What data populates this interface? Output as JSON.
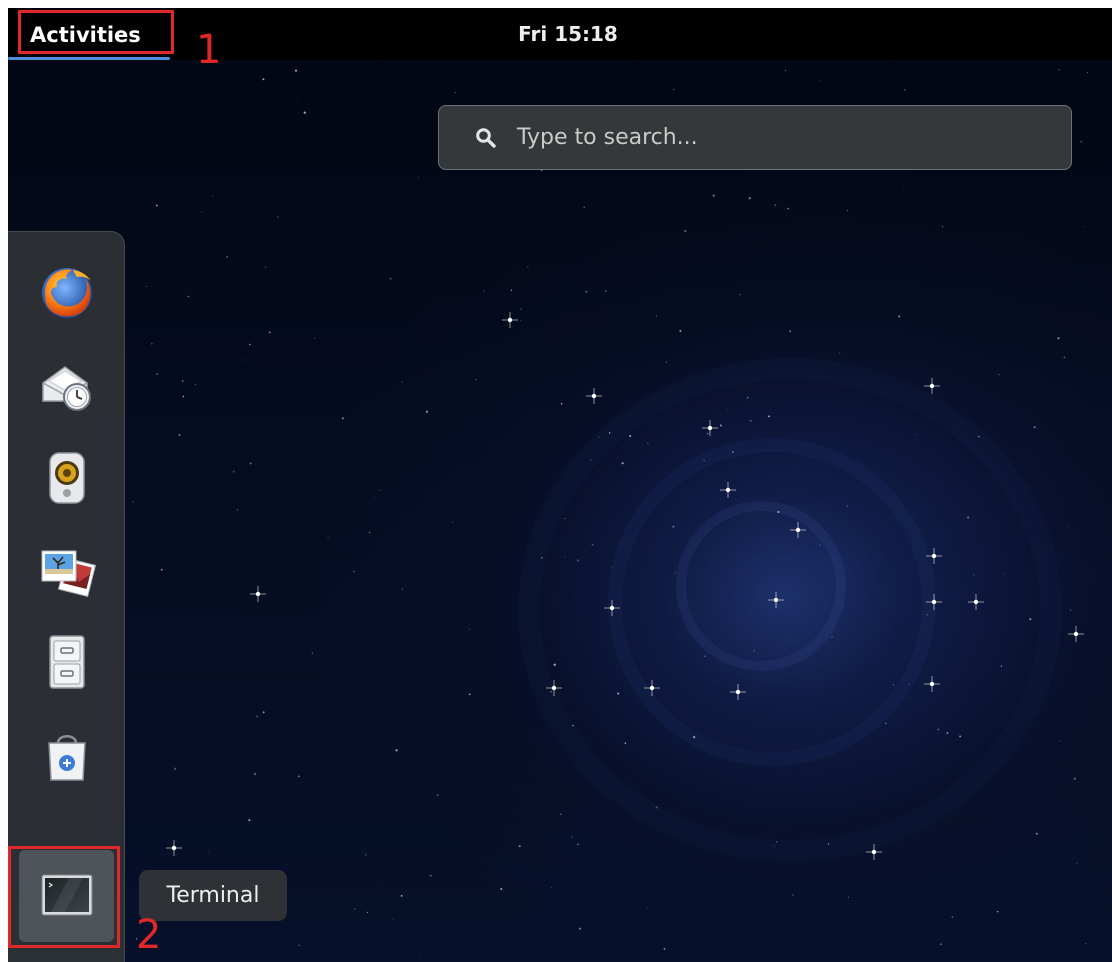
{
  "top_bar": {
    "activities_label": "Activities",
    "clock": "Fri 15:18"
  },
  "search": {
    "placeholder": "Type to search..."
  },
  "dash": {
    "items": [
      {
        "name": "firefox",
        "icon": "firefox-icon"
      },
      {
        "name": "evolution-mail",
        "icon": "mail-clock-icon"
      },
      {
        "name": "rhythmbox",
        "icon": "speaker-icon"
      },
      {
        "name": "shotwell",
        "icon": "photos-icon"
      },
      {
        "name": "files",
        "icon": "file-cabinet-icon"
      },
      {
        "name": "software",
        "icon": "shopping-bag-icon"
      },
      {
        "name": "terminal",
        "icon": "terminal-icon",
        "selected": true
      }
    ]
  },
  "tooltip": {
    "label": "Terminal"
  },
  "annotations": {
    "step1": "1",
    "step2": "2",
    "color": "#e02828"
  },
  "colors": {
    "accent": "#4a90d9",
    "top_bar": "#000000",
    "search_bg": "#34383b",
    "dash_bg": "#2e3236"
  }
}
